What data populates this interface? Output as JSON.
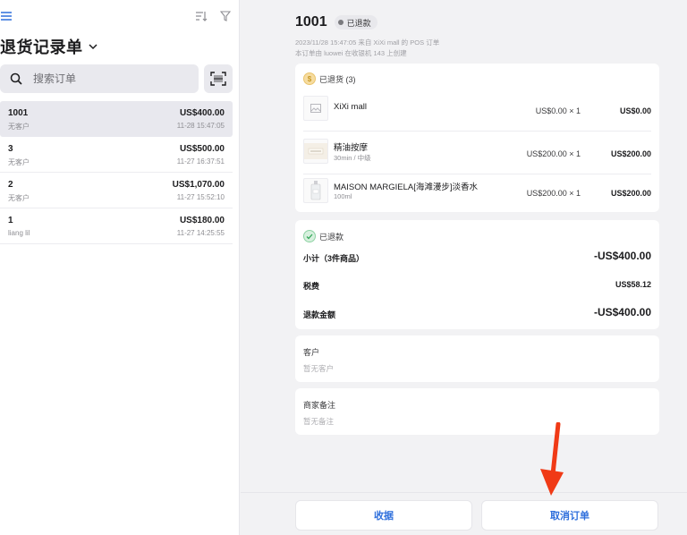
{
  "sidebar": {
    "title": "退货记录单",
    "search_placeholder": "搜索订单",
    "orders": [
      {
        "id": "1001",
        "amount": "US$400.00",
        "customer": "无客户",
        "time": "11-28 15:47:05",
        "selected": true
      },
      {
        "id": "3",
        "amount": "US$500.00",
        "customer": "无客户",
        "time": "11-27 16:37:51"
      },
      {
        "id": "2",
        "amount": "US$1,070.00",
        "customer": "无客户",
        "time": "11-27 15:52:10"
      },
      {
        "id": "1",
        "amount": "US$180.00",
        "customer": "liang lil",
        "time": "11-27 14:25:55"
      }
    ]
  },
  "detail": {
    "order_number": "1001",
    "status_badge": "已退款",
    "meta_line1": "2023/11/28 15:47:05 来自 XiXi mall 的 POS 订单",
    "meta_line2": "本订单由 luowei 在收银机 143 上创建",
    "returned_header": "已退货 (3)",
    "items": [
      {
        "name": "XiXi mall",
        "sub": "",
        "unit": "US$0.00 × 1",
        "total": "US$0.00"
      },
      {
        "name": "精油按摩",
        "sub": "30min / 中级",
        "unit": "US$200.00 × 1",
        "total": "US$200.00"
      },
      {
        "name": "MAISON MARGIELA[海滩漫步]淡香水",
        "sub": "100ml",
        "unit": "US$200.00 × 1",
        "total": "US$200.00"
      }
    ],
    "refund_header": "已退款",
    "subtotal_label": "小计（3件商品）",
    "subtotal_value": "-US$400.00",
    "tax_label": "税费",
    "tax_value": "US$58.12",
    "refund_label": "退款金额",
    "refund_value": "-US$400.00",
    "customer_label": "客户",
    "customer_value": "暂无客户",
    "note_label": "商家备注",
    "note_value": "暂无备注"
  },
  "footer": {
    "receipt_button": "收据",
    "cancel_button": "取消订单"
  },
  "colors": {
    "accent": "#2f6fdc",
    "arrow": "#f03a16",
    "selected_row": "#e8e8ee"
  }
}
